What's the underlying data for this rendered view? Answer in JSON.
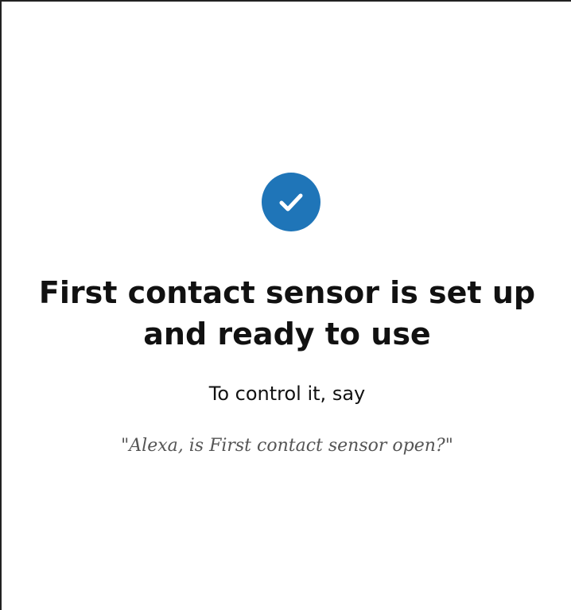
{
  "confirmation": {
    "icon": "checkmark-circle-icon",
    "accent_color": "#1f75b8",
    "title": "First contact sensor is set up and ready to use",
    "instruction": "To control it, say",
    "example_utterance": "\"Alexa, is First contact sensor open?\""
  }
}
